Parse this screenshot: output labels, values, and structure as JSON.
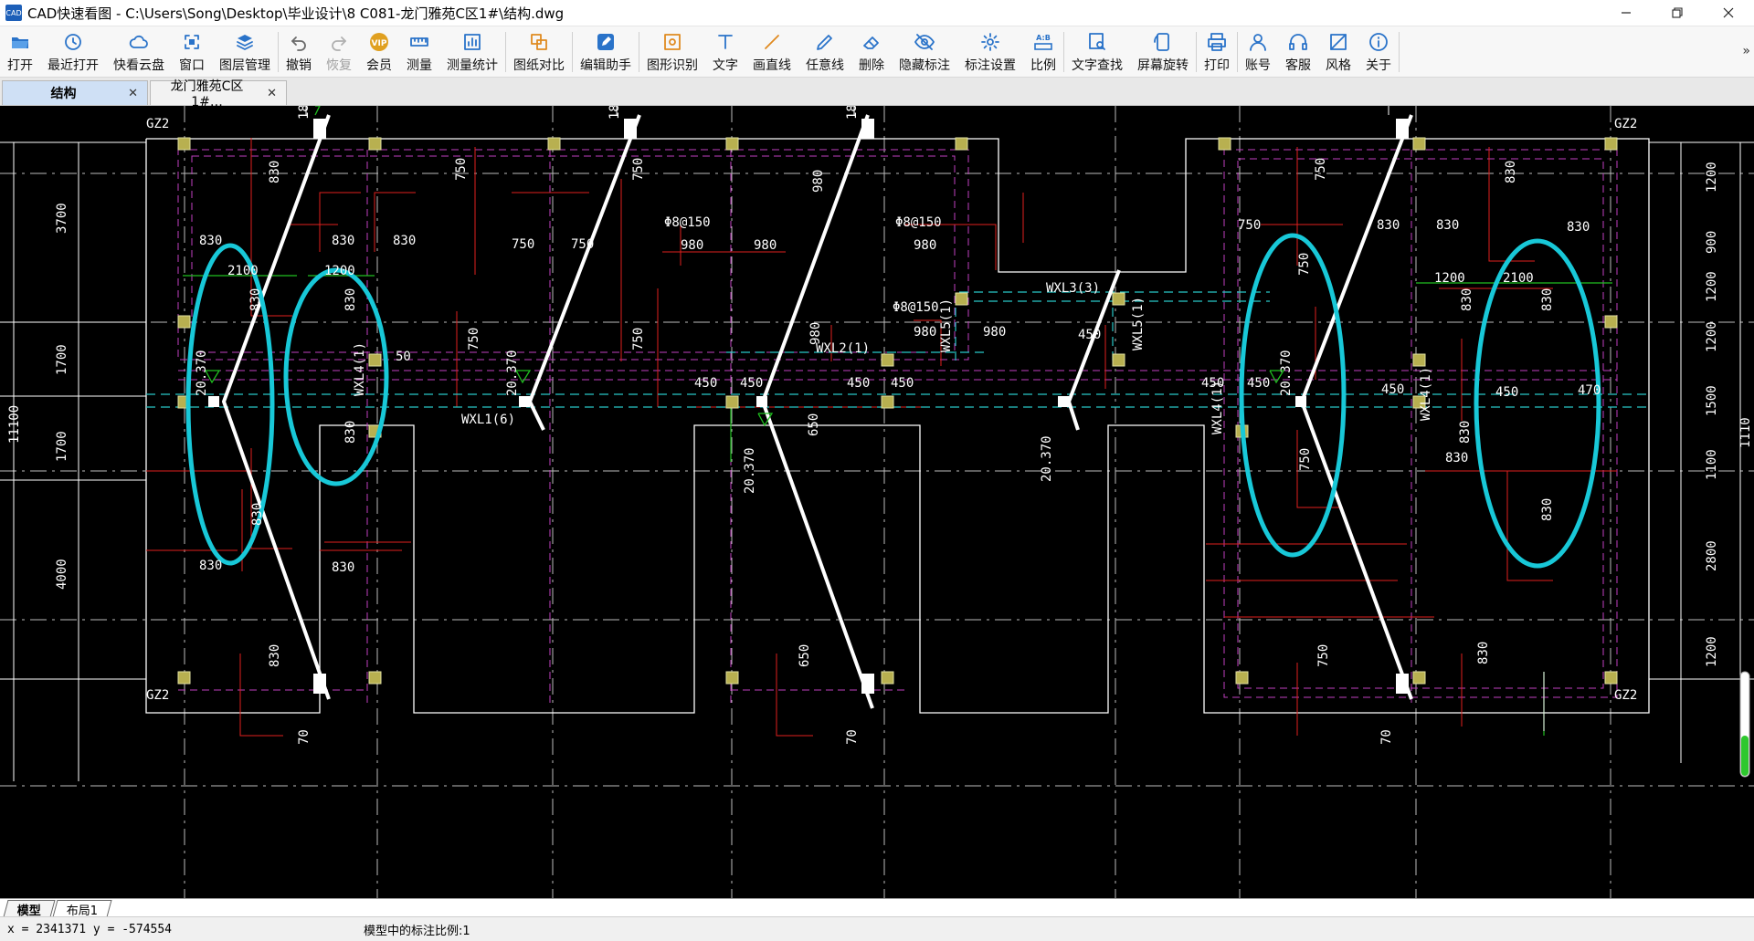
{
  "window": {
    "app_icon_text": "CAD",
    "title": "CAD快速看图 - C:\\Users\\Song\\Desktop\\毕业设计\\8 C081-龙门雅苑C区1#\\结构.dwg"
  },
  "toolbar": [
    {
      "label": "打开",
      "icon": "folder-open-icon",
      "color": "#2a73c9"
    },
    {
      "label": "最近打开",
      "icon": "clock-icon",
      "color": "#2a73c9"
    },
    {
      "label": "快看云盘",
      "icon": "cloud-icon",
      "color": "#2a73c9"
    },
    {
      "label": "窗口",
      "icon": "window-icon",
      "color": "#2a73c9"
    },
    {
      "label": "图层管理",
      "icon": "layers-icon",
      "color": "#2a73c9"
    },
    {
      "label": "撤销",
      "icon": "undo-icon",
      "color": "#6a6a6a"
    },
    {
      "label": "恢复",
      "icon": "redo-icon",
      "color": "#b0b0b0",
      "disabled": true
    },
    {
      "label": "会员",
      "icon": "vip-icon",
      "color": "#e0a020"
    },
    {
      "label": "测量",
      "icon": "ruler-icon",
      "color": "#2a73c9"
    },
    {
      "label": "测量统计",
      "icon": "measure-stats-icon",
      "color": "#2a73c9"
    },
    {
      "label": "图纸对比",
      "icon": "compare-icon",
      "color": "#e08a20"
    },
    {
      "label": "编辑助手",
      "icon": "edit-assistant-icon",
      "color": "#2a73c9"
    },
    {
      "label": "图形识别",
      "icon": "shape-recognize-icon",
      "color": "#e08a20"
    },
    {
      "label": "文字",
      "icon": "text-icon",
      "color": "#2a73c9"
    },
    {
      "label": "画直线",
      "icon": "line-icon",
      "color": "#e08a20"
    },
    {
      "label": "任意线",
      "icon": "freehand-icon",
      "color": "#2a73c9"
    },
    {
      "label": "删除",
      "icon": "eraser-icon",
      "color": "#2a73c9"
    },
    {
      "label": "隐藏标注",
      "icon": "eye-hide-icon",
      "color": "#2a73c9"
    },
    {
      "label": "标注设置",
      "icon": "annotation-settings-icon",
      "color": "#2a73c9"
    },
    {
      "label": "比例",
      "icon": "ratio-icon",
      "color": "#2a73c9"
    },
    {
      "label": "文字查找",
      "icon": "text-search-icon",
      "color": "#2a73c9"
    },
    {
      "label": "屏幕旋转",
      "icon": "rotate-screen-icon",
      "color": "#2a73c9"
    },
    {
      "label": "打印",
      "icon": "printer-icon",
      "color": "#2a73c9"
    },
    {
      "label": "账号",
      "icon": "user-icon",
      "color": "#2a73c9"
    },
    {
      "label": "客服",
      "icon": "headset-icon",
      "color": "#2a73c9"
    },
    {
      "label": "风格",
      "icon": "style-icon",
      "color": "#2a73c9"
    },
    {
      "label": "关于",
      "icon": "info-icon",
      "color": "#2a73c9"
    }
  ],
  "doc_tabs": [
    {
      "label": "结构",
      "active": true
    },
    {
      "label": "龙门雅苑C区1#…",
      "active": false
    }
  ],
  "drawing": {
    "column_tag": "GZ2",
    "left_dims": [
      "3700",
      "1700",
      "1700",
      "4000"
    ],
    "left_total": "11100",
    "right_dims": [
      "1200",
      "900",
      "1200",
      "1200",
      "1500",
      "1100",
      "2800",
      "1200"
    ],
    "right_total": "1110",
    "elevation": "20.370",
    "rebar": "Φ8@150",
    "beams": [
      "WXL1(6)",
      "WXL2(1)",
      "WXL3(3)",
      "WXL4(1)",
      "WXL5(1)"
    ],
    "top_marks": "18",
    "bottom_marks": "70",
    "values": [
      "830",
      "750",
      "980",
      "450",
      "650",
      "2100",
      "1200",
      "470",
      "50"
    ]
  },
  "layout_tabs": [
    {
      "label": "模型",
      "active": true
    },
    {
      "label": "布局1",
      "active": false
    }
  ],
  "status": {
    "coords": "x = 2341371  y = -574554",
    "scale_text": "模型中的标注比例:1"
  }
}
